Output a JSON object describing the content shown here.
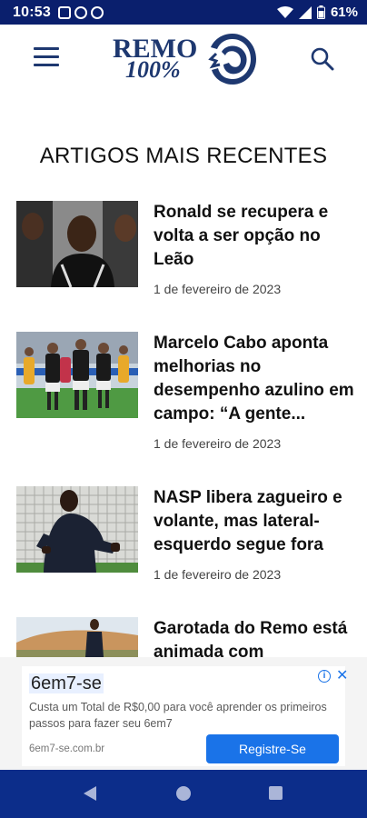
{
  "status_bar": {
    "time": "10:53",
    "battery": "61%",
    "icons_left": [
      "image-icon",
      "whatsapp-icon",
      "sync-icon"
    ],
    "icons_right": [
      "wifi-icon",
      "signal-icon",
      "battery-icon"
    ]
  },
  "header": {
    "logo_text_top": "REMO",
    "logo_text_bottom": "100%",
    "menu_icon": "hamburger-menu-icon",
    "search_icon": "search-icon",
    "brand_color": "#1e3870"
  },
  "section_title": "ARTIGOS MAIS RECENTES",
  "articles": [
    {
      "title": "Ronald se recupera e volta a ser opção no Leão",
      "date": "1 de fevereiro de 2023"
    },
    {
      "title": "Marcelo Cabo aponta melhorias no desempenho azulino em campo: “A gente...",
      "date": "1 de fevereiro de 2023"
    },
    {
      "title": "NASP libera zagueiro e volante, mas lateral-esquerdo segue fora",
      "date": "1 de fevereiro de 2023"
    },
    {
      "title": "Garotada do Remo está animada com",
      "date": ""
    }
  ],
  "ad": {
    "title": "6em7-se",
    "description": "Custa um Total de R$0,00 para você aprender os primeiros passos para fazer seu 6em7",
    "url": "6em7-se.com.br",
    "button": "Registre-Se",
    "button_color": "#1a73e8"
  },
  "nav_bar": {
    "icons": [
      "back-icon",
      "home-icon",
      "recents-icon"
    ],
    "color": "#0c2d8a"
  }
}
